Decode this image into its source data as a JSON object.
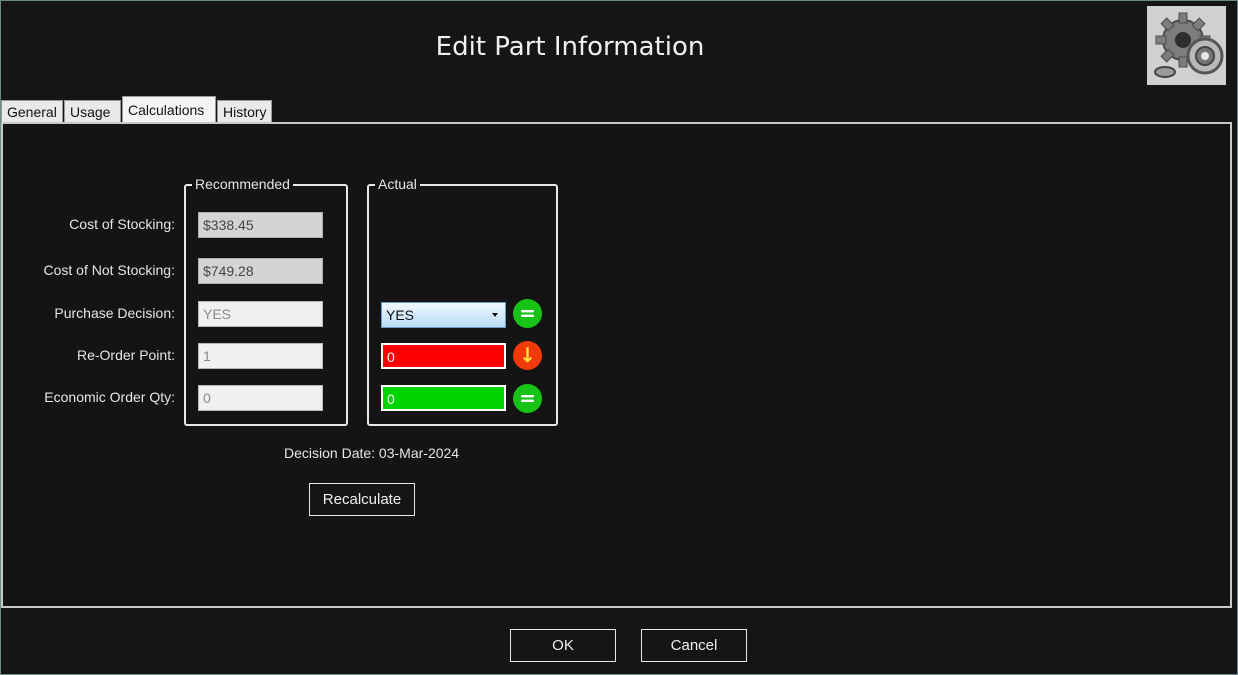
{
  "window": {
    "title": "Edit Part Information"
  },
  "tabs": [
    {
      "label": "General"
    },
    {
      "label": "Usage"
    },
    {
      "label": "Calculations"
    },
    {
      "label": "History"
    }
  ],
  "groups": {
    "recommended": "Recommended",
    "actual": "Actual"
  },
  "rows": {
    "cost_stocking": {
      "label": "Cost of Stocking:",
      "recommended": "$338.45"
    },
    "cost_not_stocking": {
      "label": "Cost of Not Stocking:",
      "recommended": "$749.28"
    },
    "purchase_decision": {
      "label": "Purchase Decision:",
      "recommended": "YES",
      "actual": "YES"
    },
    "reorder_point": {
      "label": "Re-Order Point:",
      "recommended": "1",
      "actual": "0"
    },
    "eoq": {
      "label": "Economic Order Qty:",
      "recommended": "0",
      "actual": "0"
    }
  },
  "status_icons": {
    "equal": "=",
    "down": "↓"
  },
  "decision_date": "Decision Date: 03-Mar-2024",
  "buttons": {
    "recalculate": "Recalculate",
    "ok": "OK",
    "cancel": "Cancel"
  },
  "colors": {
    "background": "#151515",
    "red_field": "#ff0000",
    "green_field": "#00d400",
    "status_equal": "#16c316",
    "status_down": "#f03a0a"
  }
}
